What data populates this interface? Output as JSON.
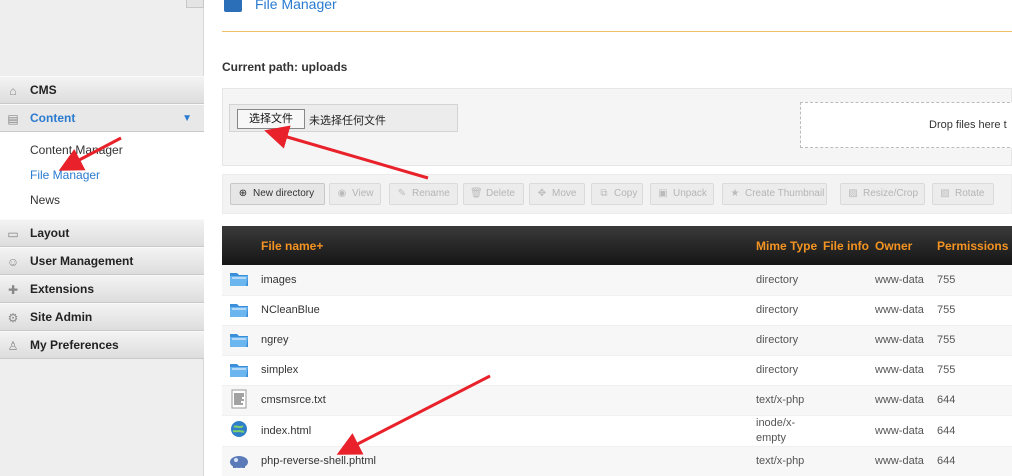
{
  "sidebar": {
    "items": [
      {
        "label": "CMS",
        "icon": "home-icon"
      },
      {
        "label": "Content",
        "icon": "content-icon",
        "active": true
      },
      {
        "label": "Layout",
        "icon": "layout-icon"
      },
      {
        "label": "User Management",
        "icon": "users-icon"
      },
      {
        "label": "Extensions",
        "icon": "extensions-icon"
      },
      {
        "label": "Site Admin",
        "icon": "gear-icon"
      },
      {
        "label": "My Preferences",
        "icon": "user-icon"
      }
    ],
    "subitems": [
      "Content Manager",
      "File Manager",
      "News"
    ],
    "selected_subitem": "File Manager"
  },
  "header": {
    "title": "File Manager"
  },
  "path": {
    "text": "Current path: uploads"
  },
  "upload": {
    "button": "选择文件",
    "status": "未选择任何文件",
    "dropzone": "Drop files here t"
  },
  "toolbar": {
    "buttons": [
      "New directory",
      "View",
      "Rename",
      "Delete",
      "Move",
      "Copy",
      "Unpack",
      "Create Thumbnail",
      "Resize/Crop",
      "Rotate"
    ]
  },
  "table": {
    "headers": [
      "File name+",
      "Mime Type",
      "File info",
      "Owner",
      "Permissions"
    ],
    "rows": [
      {
        "name": "images",
        "mime": "directory",
        "owner": "www-data",
        "perm": "755",
        "icon": "folder-icon"
      },
      {
        "name": "NCleanBlue",
        "mime": "directory",
        "owner": "www-data",
        "perm": "755",
        "icon": "folder-icon"
      },
      {
        "name": "ngrey",
        "mime": "directory",
        "owner": "www-data",
        "perm": "755",
        "icon": "folder-icon"
      },
      {
        "name": "simplex",
        "mime": "directory",
        "owner": "www-data",
        "perm": "755",
        "icon": "folder-icon"
      },
      {
        "name": "cmsmsrce.txt",
        "mime": "text/x-php",
        "owner": "www-data",
        "perm": "644",
        "icon": "text-file-icon"
      },
      {
        "name": "index.html",
        "mime": "inode/x-empty",
        "owner": "www-data",
        "perm": "644",
        "icon": "html-file-icon"
      },
      {
        "name": "php-reverse-shell.phtml",
        "mime": "text/x-php",
        "owner": "www-data",
        "perm": "644",
        "icon": "php-file-icon"
      }
    ]
  },
  "colors": {
    "accent": "#2a7bd0",
    "header_text": "#f49321",
    "arrow": "#e8212a"
  }
}
